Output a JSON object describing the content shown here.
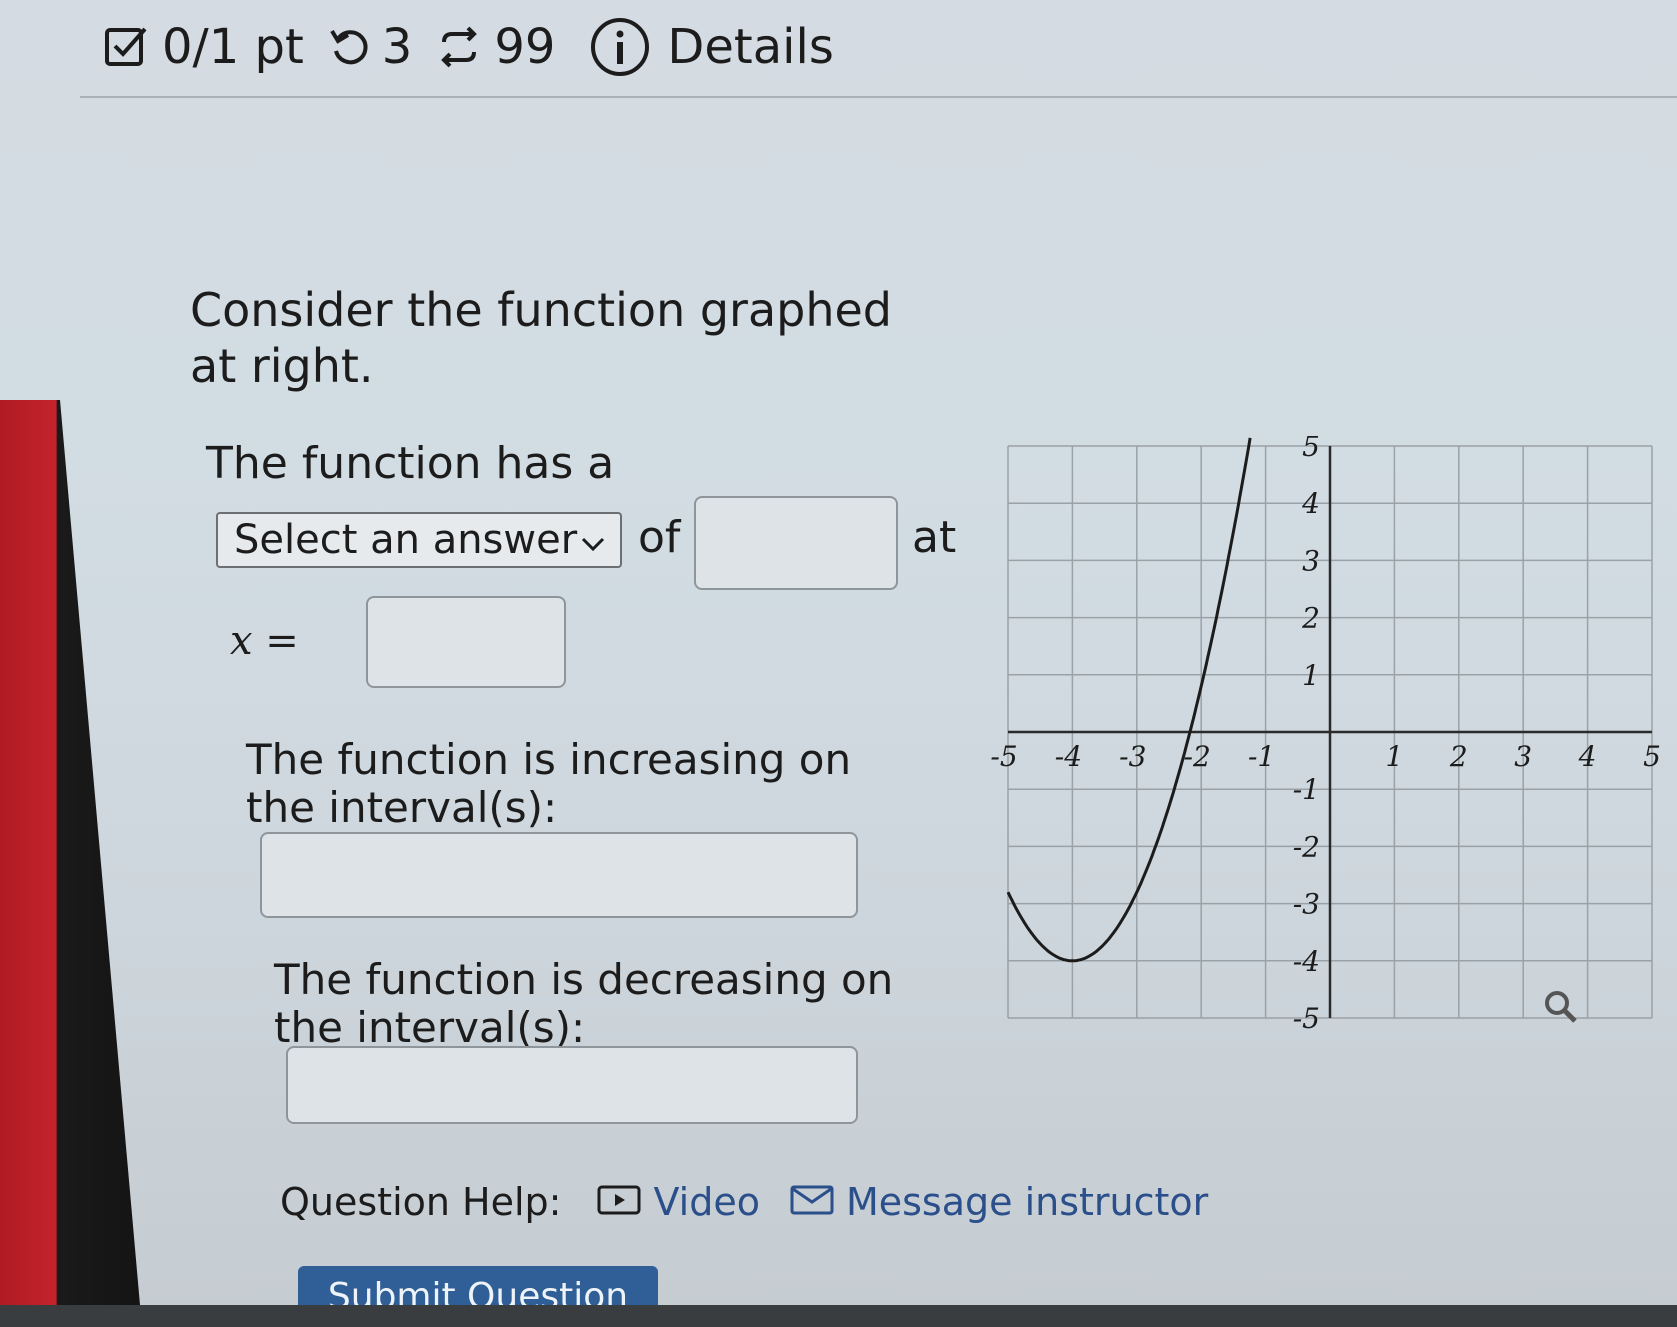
{
  "header": {
    "score": "0/1 pt",
    "retries": "3",
    "attempts": "99",
    "details": "Details"
  },
  "question": {
    "intro": "Consider the function graphed at right.",
    "has_a": "The function has a",
    "select_placeholder": "Select an answer",
    "of": "of",
    "at": "at",
    "x_label": "x =",
    "increasing_label": "The function is increasing on the interval(s):",
    "decreasing_label": "The function is decreasing on the interval(s):"
  },
  "help": {
    "label": "Question Help:",
    "video": "Video",
    "message": "Message instructor"
  },
  "submit_label": "Submit Question",
  "graph": {
    "x_ticks": [
      "-5",
      "-4",
      "-3",
      "-2",
      "-1",
      "1",
      "2",
      "3",
      "4",
      "5"
    ],
    "y_ticks": [
      "5",
      "4",
      "3",
      "2",
      "1",
      "-1",
      "-2",
      "-3",
      "-4",
      "-5"
    ],
    "xlim": [
      -5,
      5
    ],
    "ylim": [
      -5,
      5
    ],
    "curve": {
      "type": "parabola",
      "vertex": [
        -4,
        -4
      ],
      "a": 1.2
    },
    "zoom_icon": "magnifier-icon"
  }
}
